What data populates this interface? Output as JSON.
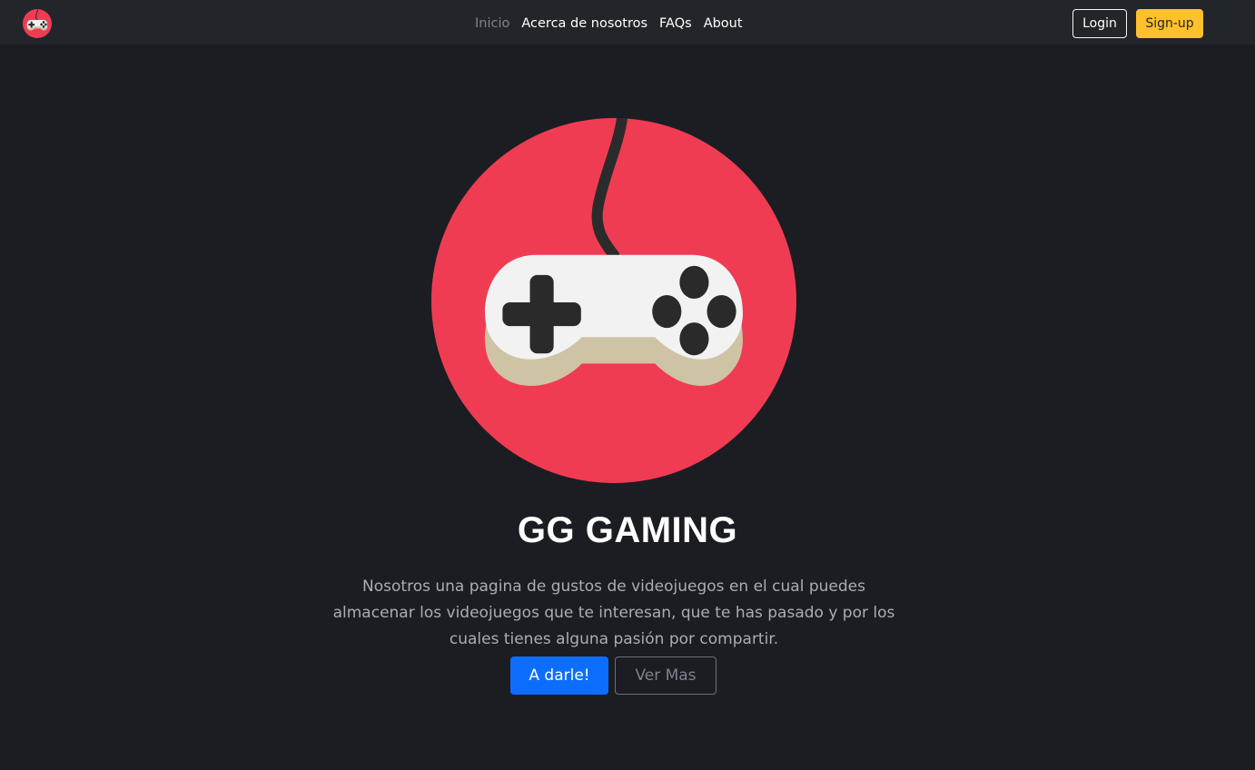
{
  "navbar": {
    "logo_icon": "gamepad-logo-icon",
    "links": [
      {
        "label": "Inicio",
        "active": true
      },
      {
        "label": "Acerca de nosotros"
      },
      {
        "label": "FAQs"
      },
      {
        "label": "About"
      }
    ],
    "login_label": "Login",
    "signup_label": "Sign-up"
  },
  "hero": {
    "logo_icon": "gamepad-logo-icon",
    "title": "GG GAMING",
    "description_lines": [
      "Nosotros una pagina de gustos de videojuegos en el cual puedes",
      "almacenar los videojuegos que te interesan, que te has pasado y por los",
      "cuales tienes alguna pasión por compartir."
    ],
    "primary_button": "A darle!",
    "secondary_button": "Ver Mas"
  },
  "colors": {
    "background": "#1b1d23",
    "navbar": "#22252a",
    "logo_red": "#f03c52",
    "signup_yellow": "#ffc02d",
    "primary_blue": "#0d6efd"
  }
}
